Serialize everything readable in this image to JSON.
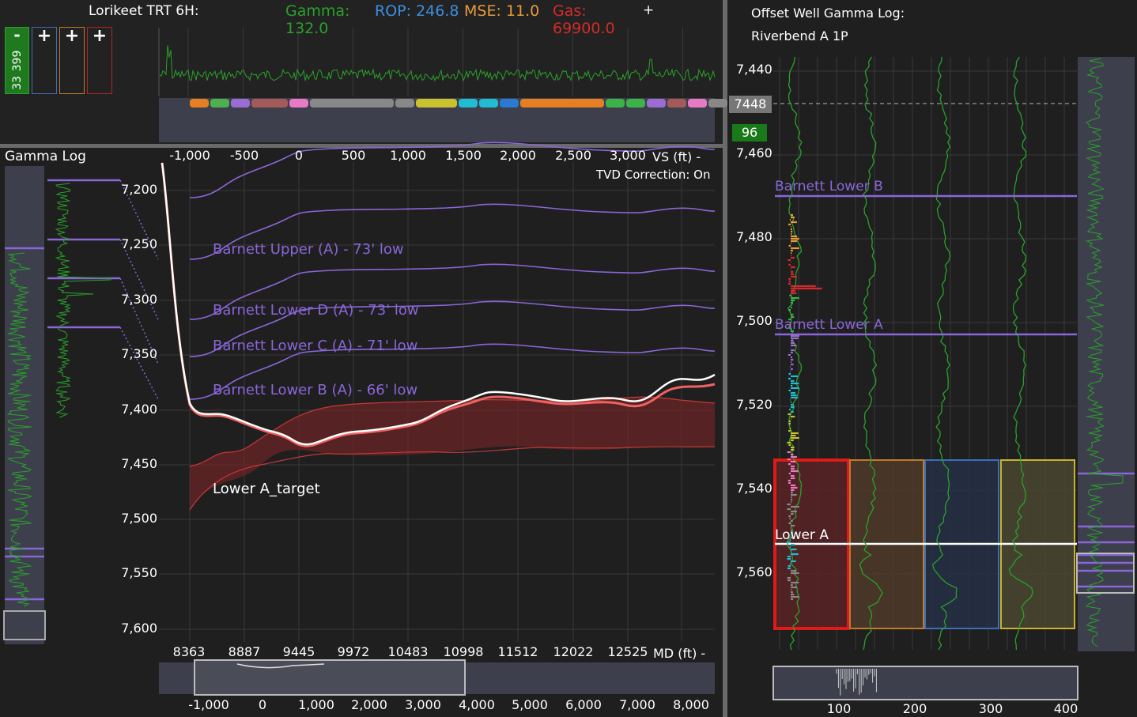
{
  "header": {
    "title": "Lorikeet TRT 6H:",
    "gamma_label": "Gamma:",
    "gamma_value": "132.0",
    "rop_label": "ROP: 246.8",
    "mse_label": "MSE: 11.0",
    "gas_label": "Gas:",
    "gas_value": "69900.0",
    "add_button": "+",
    "color_box": {
      "top_label": "-",
      "value_top": "399",
      "value_bottom": "33"
    },
    "track_add_buttons": [
      "+",
      "+",
      "+"
    ]
  },
  "colors": {
    "gamma": "#2aa12a",
    "rop": "#3d8fe0",
    "mse": "#e89a3c",
    "gas": "#d42a2a",
    "formation": "#8a66d9",
    "target_fill": "#6b2426",
    "background": "#1f1f1f"
  },
  "strip_segments_colors": [
    "#e67e22",
    "#4caf50",
    "#9b6cd4",
    "#a55a5a",
    "#e879c4",
    "#888888",
    "#888888",
    "#c9c22e",
    "#1fbcd4",
    "#1fbcd4",
    "#2a7ad4",
    "#e67e22",
    "#3cb34a",
    "#3cb34a",
    "#9b6cd4",
    "#a55a5a",
    "#e879c4",
    "#888888",
    "#c9c22e",
    "#1fbcd4"
  ],
  "gamma_log_panel": {
    "title": "Gamma Log"
  },
  "main_chart": {
    "vs_axis_label": "VS (ft) -",
    "md_axis_label": "MD (ft) -",
    "tvd_correction": "TVD Correction: On",
    "vs_ticks": [
      "-1,000",
      "-500",
      "0",
      "500",
      "1,000",
      "1,500",
      "2,000",
      "2,500",
      "3,000"
    ],
    "tvd_ticks": [
      "7,200",
      "7,250",
      "7,300",
      "7,350",
      "7,400",
      "7,450",
      "7,500",
      "7,550",
      "7,600"
    ],
    "md_ticks": [
      "8363",
      "8887",
      "9445",
      "9972",
      "10483",
      "10998",
      "11512",
      "12022",
      "12525"
    ],
    "formation_labels": [
      "Barnett Upper (A) - 73' low",
      "Barnett Lower D (A) - 73' low",
      "Barnett Lower C (A) - 71' low",
      "Barnett Lower B (A) - 66' low"
    ],
    "target_label": "Lower A_target"
  },
  "scrubber": {
    "ticks": [
      "-1,000",
      "0",
      "1,000",
      "2,000",
      "3,000",
      "4,000",
      "5,000",
      "6,000",
      "7,000",
      "8,000"
    ]
  },
  "offset_panel": {
    "title_line1": "Offset Well Gamma Log:",
    "title_line2": "Riverbend A 1P",
    "depth_ticks": [
      "7,440",
      "7,460",
      "7,480",
      "7,500",
      "7,520",
      "7,540",
      "7,560"
    ],
    "cursor_depth": "7448",
    "cursor_gamma": "96",
    "formations": [
      "Barnett Lower B",
      "Barnett Lower A",
      "Lower A"
    ],
    "gamma_ticks": [
      "100",
      "200",
      "300",
      "400"
    ]
  }
}
